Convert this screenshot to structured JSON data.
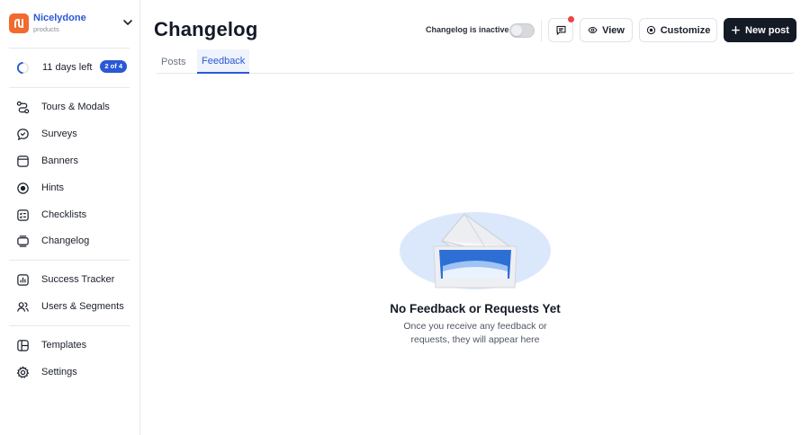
{
  "brand": {
    "name": "Nicelydone",
    "sub": "products"
  },
  "trial": {
    "text": "11 days left",
    "badge": "2 of 4",
    "progress": 0.5
  },
  "nav": {
    "tours": "Tours & Modals",
    "surveys": "Surveys",
    "banners": "Banners",
    "hints": "Hints",
    "checklists": "Checklists",
    "changelog": "Changelog",
    "success_tracker": "Success Tracker",
    "users_segments": "Users & Segments",
    "templates": "Templates",
    "settings": "Settings"
  },
  "header": {
    "title": "Changelog",
    "status_label": "Changelog is inactive",
    "view_label": "View",
    "customize_label": "Customize",
    "new_post_label": "New post"
  },
  "tabs": {
    "posts": "Posts",
    "feedback": "Feedback",
    "active": "Feedback"
  },
  "empty_state": {
    "title": "No Feedback or Requests Yet",
    "description": "Once you receive any feedback or requests, they will appear here"
  },
  "colors": {
    "accent": "#2a58d6",
    "brand_logo": "#f26a2e",
    "primary_button": "#141a26",
    "notification": "#ef4444"
  },
  "icons": {
    "brand": "nicelydone-logo",
    "tours": "route-icon",
    "surveys": "chat-bubble-icon",
    "banners": "banner-icon",
    "hints": "target-icon",
    "checklists": "checklist-icon",
    "changelog": "layers-icon",
    "success_tracker": "bar-chart-icon",
    "users_segments": "users-icon",
    "templates": "templates-icon",
    "settings": "gear-icon"
  }
}
